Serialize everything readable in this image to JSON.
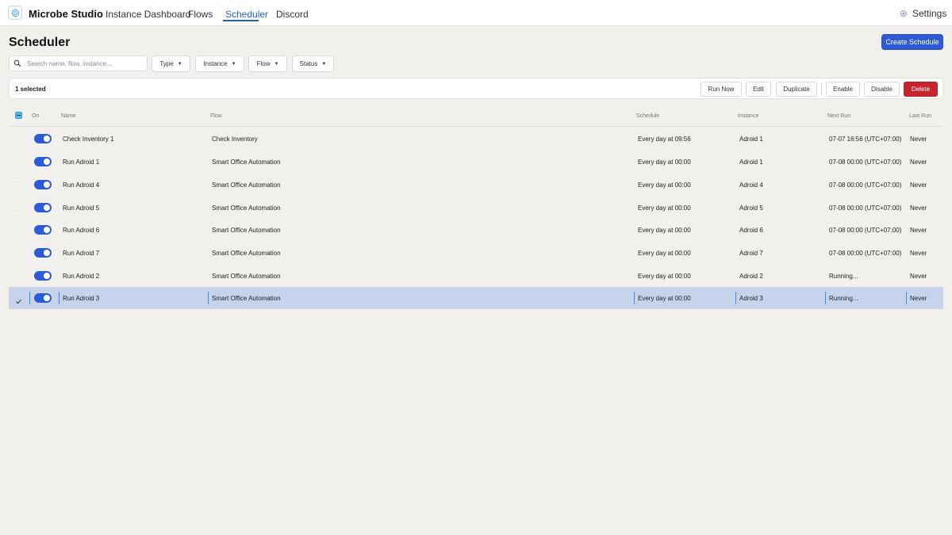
{
  "app": {
    "brand": "Microbe Studio",
    "nav": [
      {
        "label": "Instance Dashboard"
      },
      {
        "label": "Flows"
      },
      {
        "label": "Scheduler",
        "active": true
      },
      {
        "label": "Discord"
      }
    ],
    "settings_label": "Settings"
  },
  "page": {
    "title": "Scheduler",
    "create_label": "Create Schedule"
  },
  "filters": {
    "search_placeholder": "Search name, flow, instance...",
    "type_label": "Type",
    "instance_label": "Instance",
    "flow_label": "Flow",
    "status_label": "Status"
  },
  "actions": {
    "selected_count": "1 selected",
    "run_now": "Run Now",
    "edit": "Edit",
    "duplicate": "Duplicate",
    "enable": "Enable",
    "disable": "Disable",
    "delete": "Delete"
  },
  "table": {
    "columns": {
      "on": "On",
      "name": "Name",
      "flow": "Flow",
      "schedule": "Schedule",
      "instance": "Instance",
      "next_run": "Next Run",
      "last_run": "Last Run"
    },
    "rows": [
      {
        "name": "Check Inventory 1",
        "flow": "Check Inventory",
        "schedule": "Every day at 09:56",
        "instance": "Adroid 1",
        "next_run": "07-07 16:56 (UTC+07:00)",
        "last_run": "Never"
      },
      {
        "name": "Run Adroid 1",
        "flow": "Smart Office Automation",
        "schedule": "Every day at 00:00",
        "instance": "Adroid 1",
        "next_run": "07-08 00:00 (UTC+07:00)",
        "last_run": "Never"
      },
      {
        "name": "Run Adroid 4",
        "flow": "Smart Office Automation",
        "schedule": "Every day at 00:00",
        "instance": "Adroid 4",
        "next_run": "07-08 00:00 (UTC+07:00)",
        "last_run": "Never"
      },
      {
        "name": "Run Adroid 5",
        "flow": "Smart Office Automation",
        "schedule": "Every day at 00:00",
        "instance": "Adroid 5",
        "next_run": "07-08 00:00 (UTC+07:00)",
        "last_run": "Never"
      },
      {
        "name": "Run Adroid 6",
        "flow": "Smart Office Automation",
        "schedule": "Every day at 00:00",
        "instance": "Adroid 6",
        "next_run": "07-08 00:00 (UTC+07:00)",
        "last_run": "Never"
      },
      {
        "name": "Run Adroid 7",
        "flow": "Smart Office Automation",
        "schedule": "Every day at 00:00",
        "instance": "Adroid 7",
        "next_run": "07-08 00:00 (UTC+07:00)",
        "last_run": "Never"
      },
      {
        "name": "Run Adroid 2",
        "flow": "Smart Office Automation",
        "schedule": "Every day at 00:00",
        "instance": "Adroid 2",
        "next_run": "Running...",
        "last_run": "Never"
      },
      {
        "name": "Run Adroid 3",
        "flow": "Smart Office Automation",
        "schedule": "Every day at 00:00",
        "instance": "Adroid 3",
        "next_run": "Running...",
        "last_run": "Never",
        "selected": true
      }
    ]
  },
  "colors": {
    "accent": "#2f5ad6",
    "danger": "#c8232c",
    "selected_row": "#c7d3ea",
    "background": "#f1f0ed"
  },
  "icons": {
    "logo": "microbe-logo-icon",
    "settings": "gear-icon",
    "search": "search-icon",
    "caret": "caret-down-icon",
    "check": "check-icon"
  }
}
